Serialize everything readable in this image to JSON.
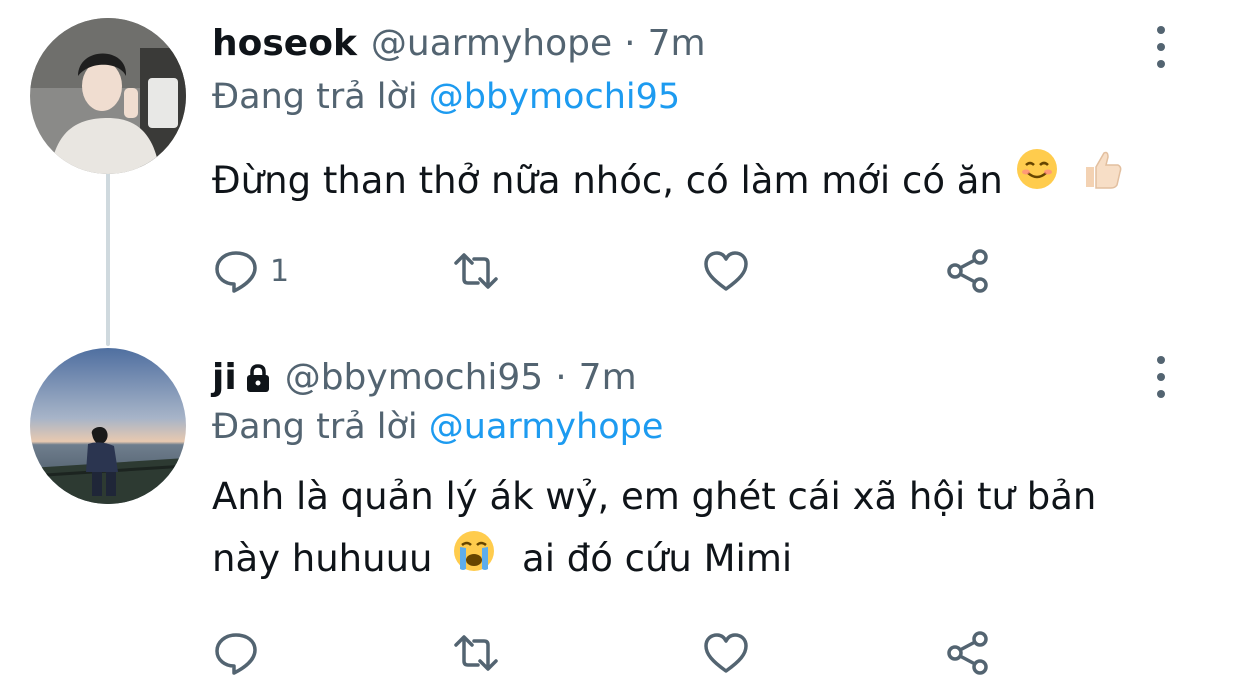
{
  "tweets": [
    {
      "name": "hoseok",
      "handle": "@uarmyhope",
      "separator": "·",
      "time": "7m",
      "replying_prefix": "Đang trả lời",
      "replying_to": "@bbymochi95",
      "text": "Đừng than thở nữa nhóc, có làm mới có ăn",
      "emojis": [
        "smiling-face-emoji",
        "thumbs-up-emoji"
      ],
      "reply_count": "1",
      "locked": false
    },
    {
      "name": "ji",
      "handle": "@bbymochi95",
      "separator": "·",
      "time": "7m",
      "replying_prefix": "Đang trả lời",
      "replying_to": "@uarmyhope",
      "text_line1": "Anh là quản lý ák wỷ, em ghét cái xã hội tư bản",
      "text_line2a": "này huhuuu",
      "text_line2b": "ai đó cứu Mimi",
      "emojis": [
        "crying-face-emoji"
      ],
      "reply_count": "",
      "locked": true
    }
  ],
  "colors": {
    "text": "#0f1419",
    "secondary": "#536471",
    "link": "#1d9bf0",
    "thread_line": "#cfd9de"
  },
  "icons": [
    "reply-icon",
    "retweet-icon",
    "like-icon",
    "share-icon",
    "more-options-icon",
    "lock-icon"
  ]
}
